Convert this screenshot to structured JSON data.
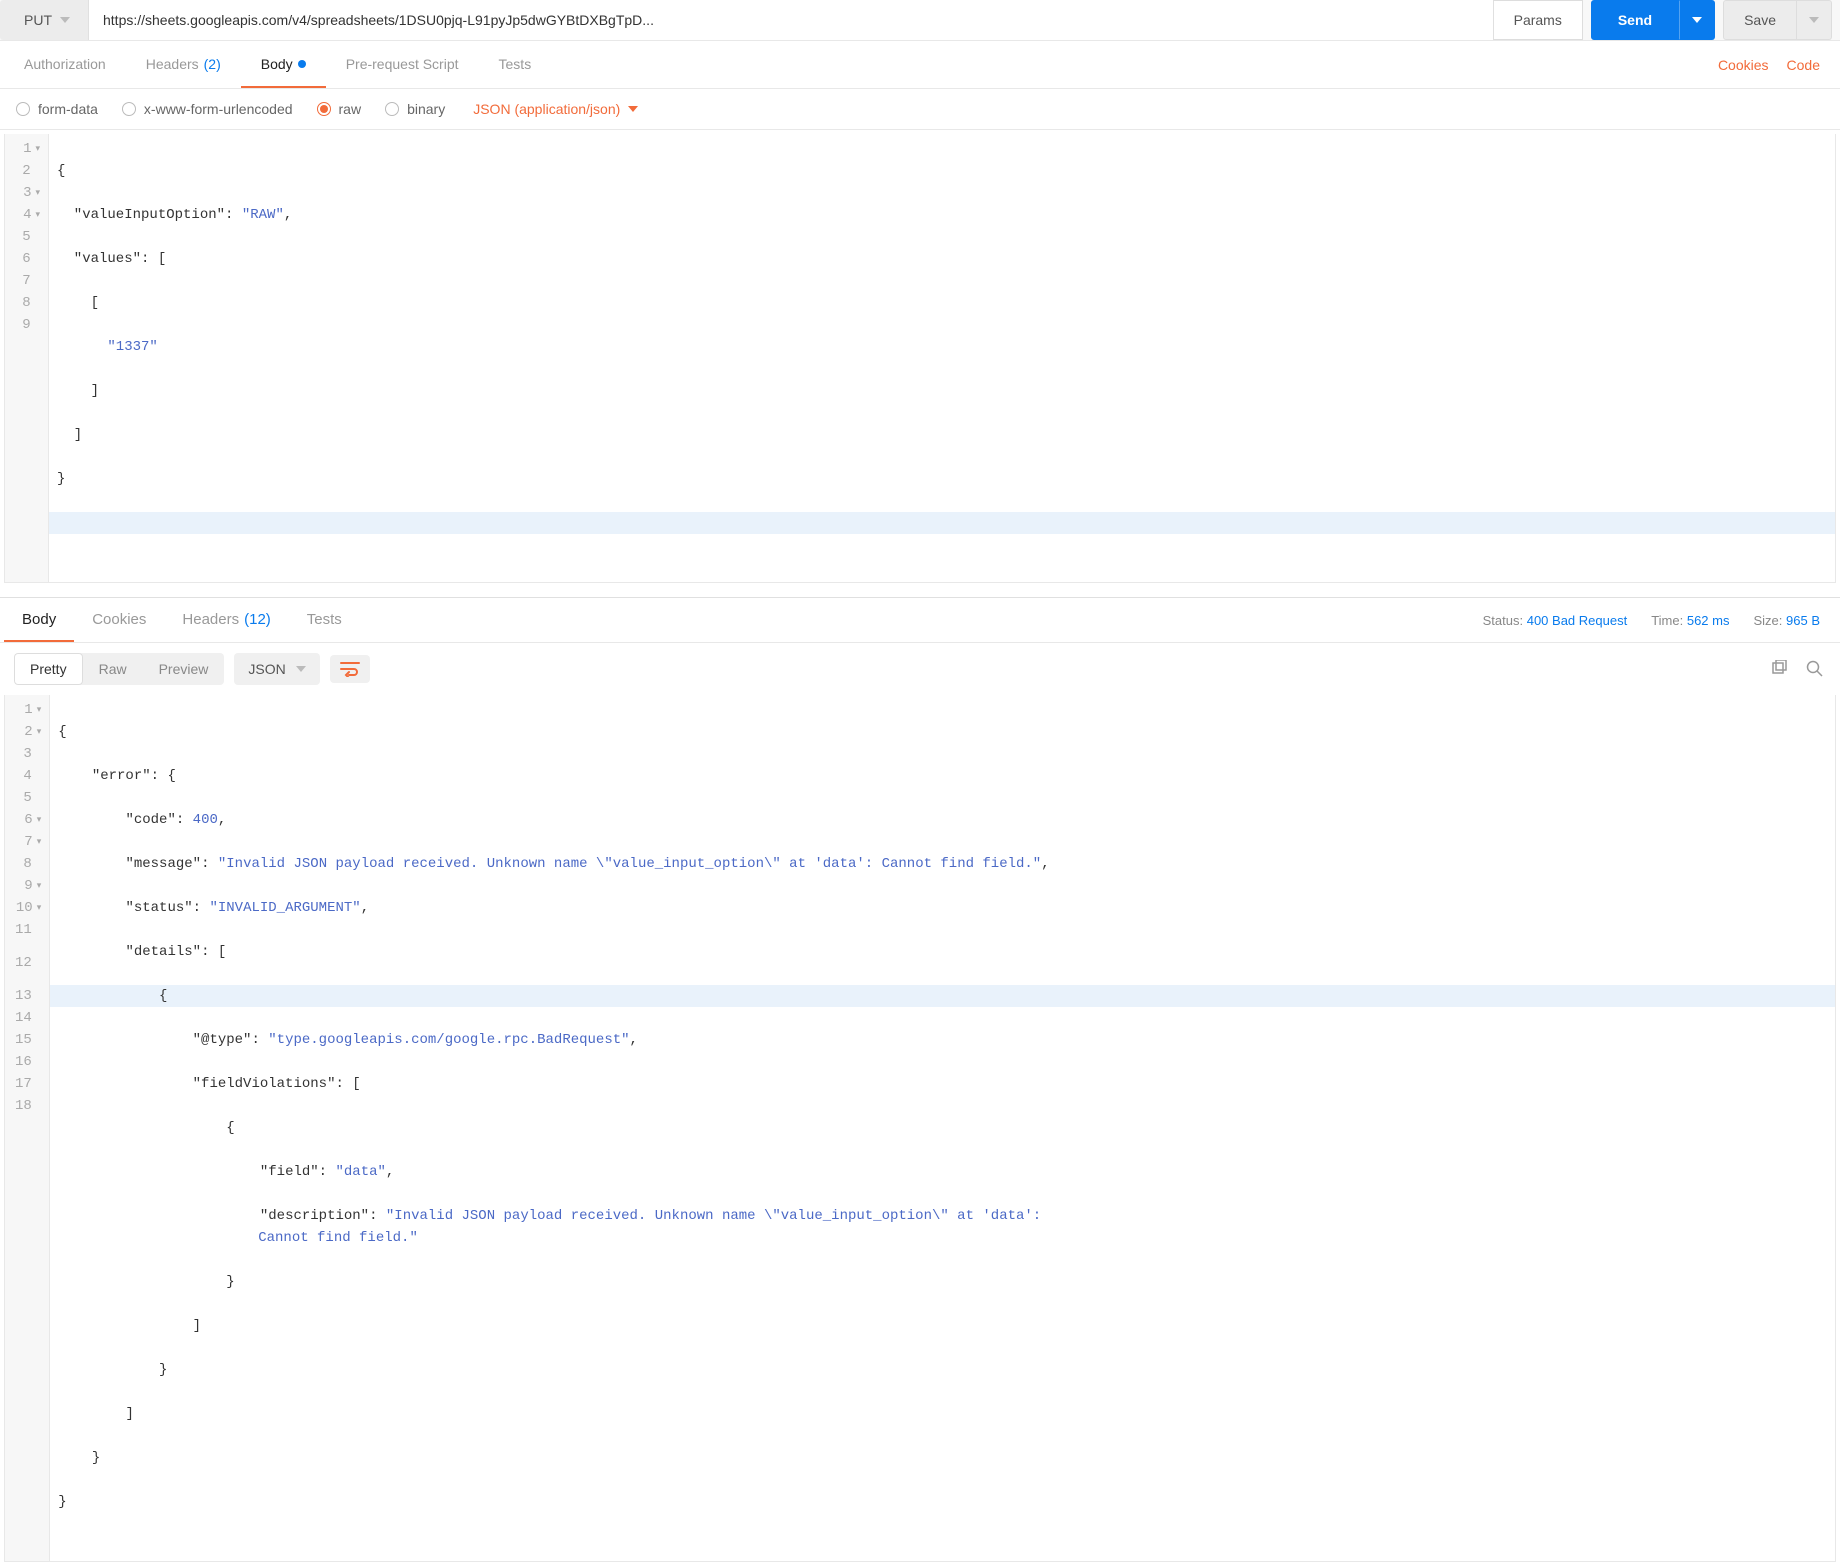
{
  "request": {
    "method": "PUT",
    "url": "https://sheets.googleapis.com/v4/spreadsheets/1DSU0pjq-L91pyJp5dwGYBtDXBgTpD...",
    "paramsLabel": "Params",
    "sendLabel": "Send",
    "saveLabel": "Save"
  },
  "reqTabs": {
    "authorization": "Authorization",
    "headers": "Headers",
    "headersCount": "(2)",
    "body": "Body",
    "prerequest": "Pre-request Script",
    "tests": "Tests",
    "cookies": "Cookies",
    "code": "Code"
  },
  "bodyTypes": {
    "formData": "form-data",
    "urlencoded": "x-www-form-urlencoded",
    "raw": "raw",
    "binary": "binary",
    "contentType": "JSON (application/json)"
  },
  "requestBody": {
    "l1": "{",
    "l2a": "  \"valueInputOption\"",
    "l2b": ": ",
    "l2c": "\"RAW\"",
    "l2d": ",",
    "l3a": "  \"values\"",
    "l3b": ": [",
    "l4": "    [",
    "l5": "      \"1337\"",
    "l6": "    ]",
    "l7": "  ]",
    "l8": "}",
    "lineNums": [
      "1",
      "2",
      "3",
      "4",
      "5",
      "6",
      "7",
      "8",
      "9"
    ]
  },
  "respTabs": {
    "body": "Body",
    "cookies": "Cookies",
    "headers": "Headers",
    "headersCount": "(12)",
    "tests": "Tests"
  },
  "status": {
    "statusLabel": "Status:",
    "statusValue": "400 Bad Request",
    "timeLabel": "Time:",
    "timeValue": "562 ms",
    "sizeLabel": "Size:",
    "sizeValue": "965 B"
  },
  "respToolbar": {
    "pretty": "Pretty",
    "raw": "Raw",
    "preview": "Preview",
    "format": "JSON"
  },
  "responseBody": {
    "l1": "{",
    "l2a": "    \"error\"",
    "l2b": ": {",
    "l3a": "        \"code\"",
    "l3b": ": ",
    "l3c": "400",
    "l3d": ",",
    "l4a": "        \"message\"",
    "l4b": ": ",
    "l4c": "\"Invalid JSON payload received. Unknown name \\\"value_input_option\\\" at 'data': Cannot find field.\"",
    "l4d": ",",
    "l5a": "        \"status\"",
    "l5b": ": ",
    "l5c": "\"INVALID_ARGUMENT\"",
    "l5d": ",",
    "l6a": "        \"details\"",
    "l6b": ": [",
    "l7": "            {",
    "l8a": "                \"@type\"",
    "l8b": ": ",
    "l8c": "\"type.googleapis.com/google.rpc.BadRequest\"",
    "l8d": ",",
    "l9a": "                \"fieldViolations\"",
    "l9b": ": [",
    "l10": "                    {",
    "l11a": "                        \"field\"",
    "l11b": ": ",
    "l11c": "\"data\"",
    "l11d": ",",
    "l12a": "                        \"description\"",
    "l12b": ": ",
    "l12c": "\"Invalid JSON payload received. Unknown name \\\"value_input_option\\\" at 'data': ",
    "l12cont": "Cannot find field.\"",
    "l13": "                    }",
    "l14": "                ]",
    "l15": "            }",
    "l16": "        ]",
    "l17": "    }",
    "l18": "}",
    "lineNums": [
      "1",
      "2",
      "3",
      "4",
      "5",
      "6",
      "7",
      "8",
      "9",
      "10",
      "11",
      "12",
      "13",
      "14",
      "15",
      "16",
      "17",
      "18"
    ]
  }
}
